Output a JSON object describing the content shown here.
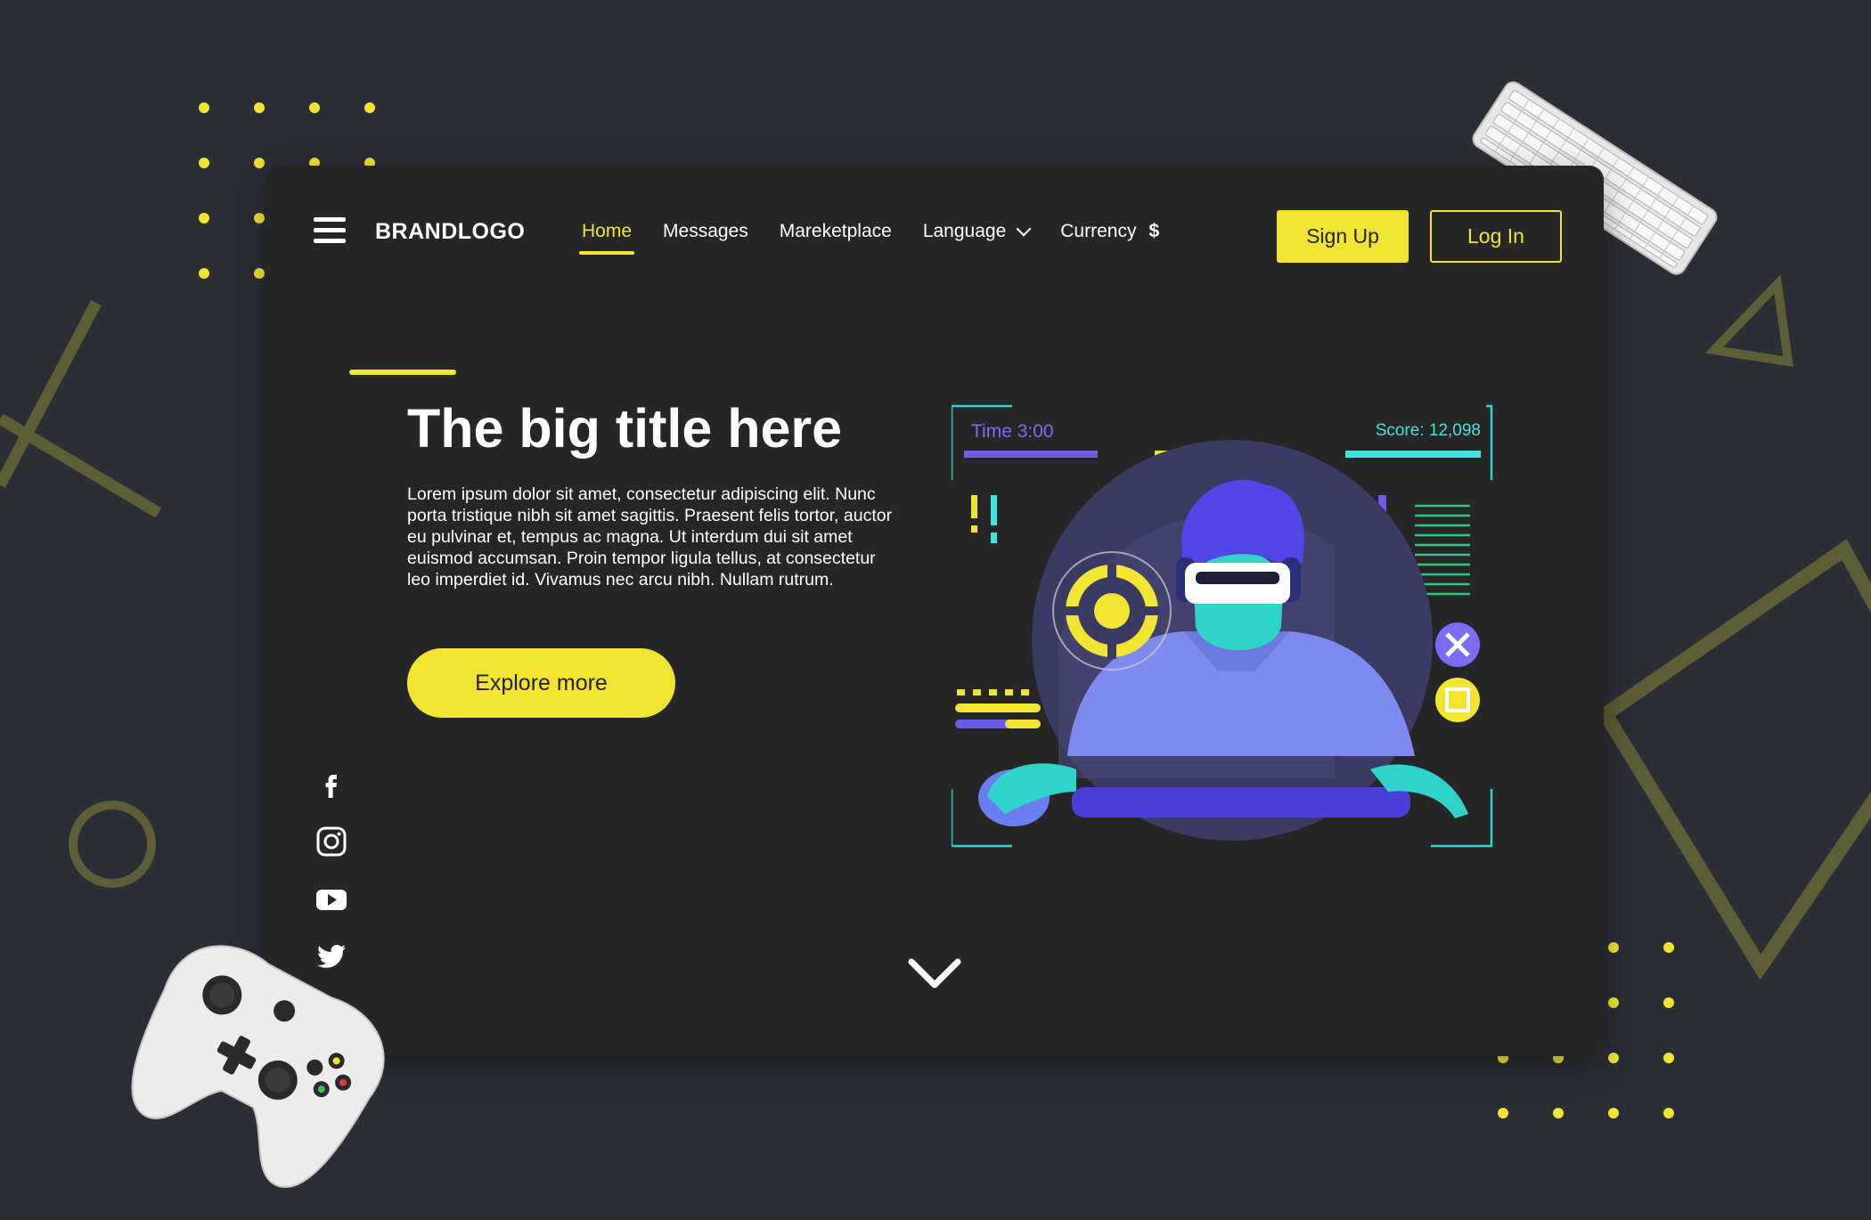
{
  "header": {
    "brand": "BRANDLOGO",
    "nav": [
      {
        "label": "Home",
        "active": true
      },
      {
        "label": "Messages"
      },
      {
        "label": "Mareketplace"
      },
      {
        "label": "Language"
      },
      {
        "label": "Currency"
      }
    ],
    "currency_symbol": "$",
    "signup_label": "Sign Up",
    "login_label": "Log In"
  },
  "hero": {
    "title": "The big title here",
    "body": "Lorem ipsum dolor sit amet, consectetur adipiscing elit. Nunc porta tristique nibh sit amet sagittis. Praesent felis tortor, auctor eu pulvinar et, tempus ac magna. Ut interdum dui sit amet euismod accumsan. Proin tempor ligula tellus, at consectetur leo imperdiet id. Vivamus nec arcu nibh. Nullam rutrum.",
    "cta_label": "Explore more"
  },
  "illustration": {
    "time_label": "Time 3:00",
    "score_label": "Score: 12,098"
  },
  "social": [
    "facebook-icon",
    "instagram-icon",
    "youtube-icon",
    "twitter-icon"
  ],
  "colors": {
    "background": "#2b2e35",
    "card": "#262626",
    "accent": "#f2e532",
    "purple": "#6c5ce7",
    "cyan": "#3ee6e0"
  }
}
